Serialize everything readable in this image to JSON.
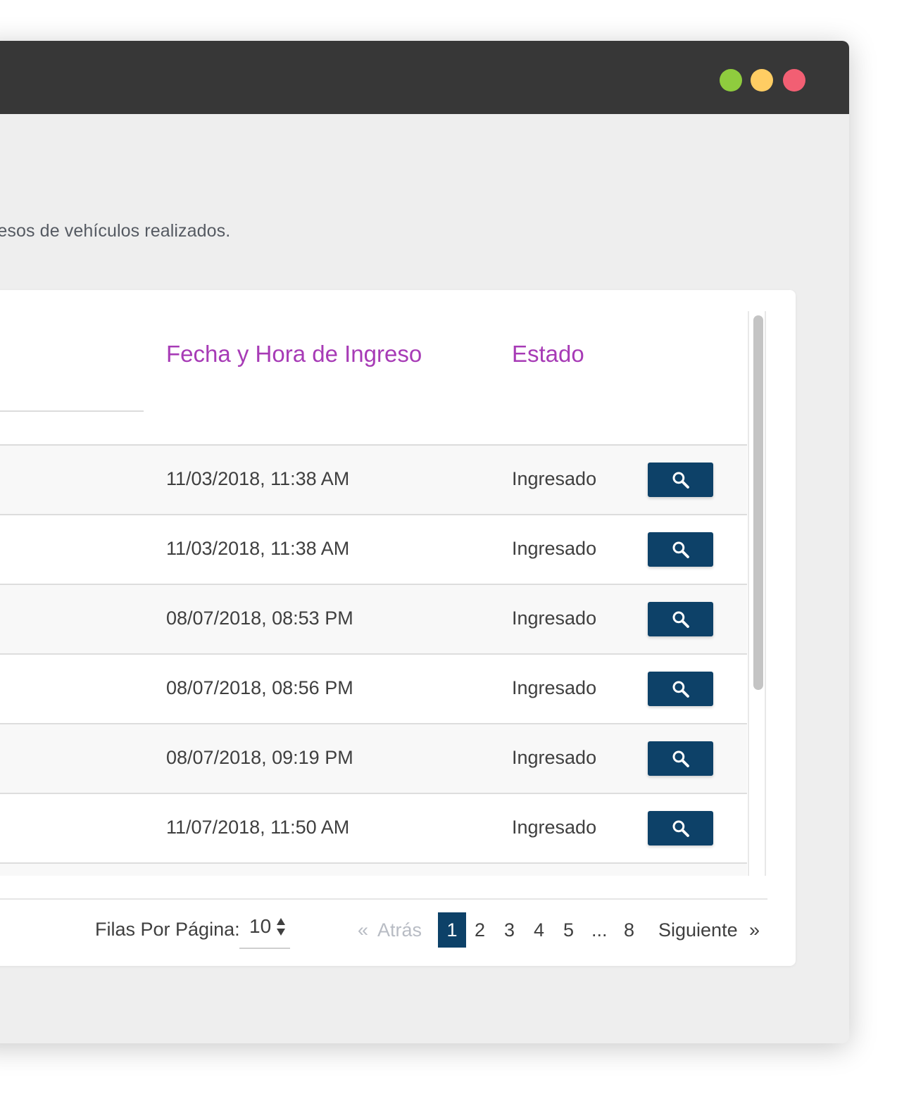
{
  "window": {
    "controls": [
      "green-dot",
      "yellow-dot",
      "red-dot"
    ]
  },
  "page": {
    "description": "ngresos de vehículos realizados."
  },
  "table": {
    "columns": {
      "fecha": "Fecha y Hora de Ingreso",
      "estado": "Estado"
    },
    "rows": [
      {
        "fecha": "11/03/2018, 11:38 AM",
        "estado": "Ingresado"
      },
      {
        "fecha": "11/03/2018, 11:38 AM",
        "estado": "Ingresado"
      },
      {
        "fecha": "08/07/2018, 08:53 PM",
        "estado": "Ingresado"
      },
      {
        "fecha": "08/07/2018, 08:56 PM",
        "estado": "Ingresado"
      },
      {
        "fecha": "08/07/2018, 09:19 PM",
        "estado": "Ingresado"
      },
      {
        "fecha": "11/07/2018, 11:50 AM",
        "estado": "Ingresado"
      }
    ],
    "row_action_icon": "search-icon"
  },
  "footer": {
    "rows_per_page_label": "Filas Por Página:",
    "rows_per_page_value": "10",
    "pagination": {
      "first_symbol": "«",
      "prev_label": "Atrás",
      "pages": [
        "1",
        "2",
        "3",
        "4",
        "5",
        "...",
        "8"
      ],
      "current_page": "1",
      "next_label": "Siguiente",
      "last_symbol": "»"
    }
  },
  "colors": {
    "accent": "#a73bb6",
    "primary": "#0d4168",
    "titlebar": "#373737"
  }
}
